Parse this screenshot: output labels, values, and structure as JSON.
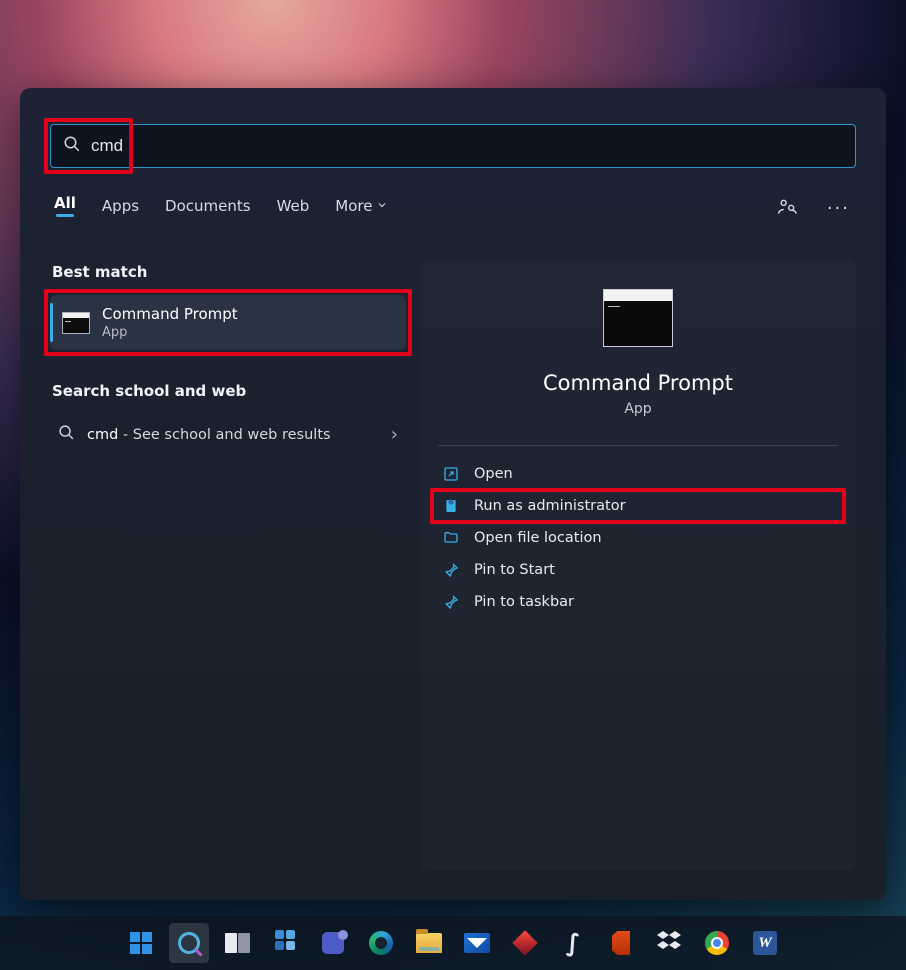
{
  "search": {
    "value": "cmd"
  },
  "tabs": {
    "items": [
      "All",
      "Apps",
      "Documents",
      "Web",
      "More"
    ],
    "active_index": 0
  },
  "left": {
    "best_match_label": "Best match",
    "result": {
      "title": "Command Prompt",
      "subtitle": "App"
    },
    "web_label": "Search school and web",
    "web_row": {
      "term": "cmd",
      "suffix": " - See school and web results"
    }
  },
  "detail": {
    "title": "Command Prompt",
    "subtitle": "App",
    "actions": [
      {
        "icon": "open",
        "label": "Open"
      },
      {
        "icon": "admin",
        "label": "Run as administrator"
      },
      {
        "icon": "folder",
        "label": "Open file location"
      },
      {
        "icon": "pin",
        "label": "Pin to Start"
      },
      {
        "icon": "pin",
        "label": "Pin to taskbar"
      }
    ]
  },
  "taskbar": {
    "items": [
      "start",
      "search",
      "task-view",
      "widgets",
      "teams",
      "edge",
      "explorer",
      "mail",
      "diamond",
      "lightning",
      "office",
      "dropbox",
      "chrome",
      "word"
    ],
    "active_index": 1
  }
}
